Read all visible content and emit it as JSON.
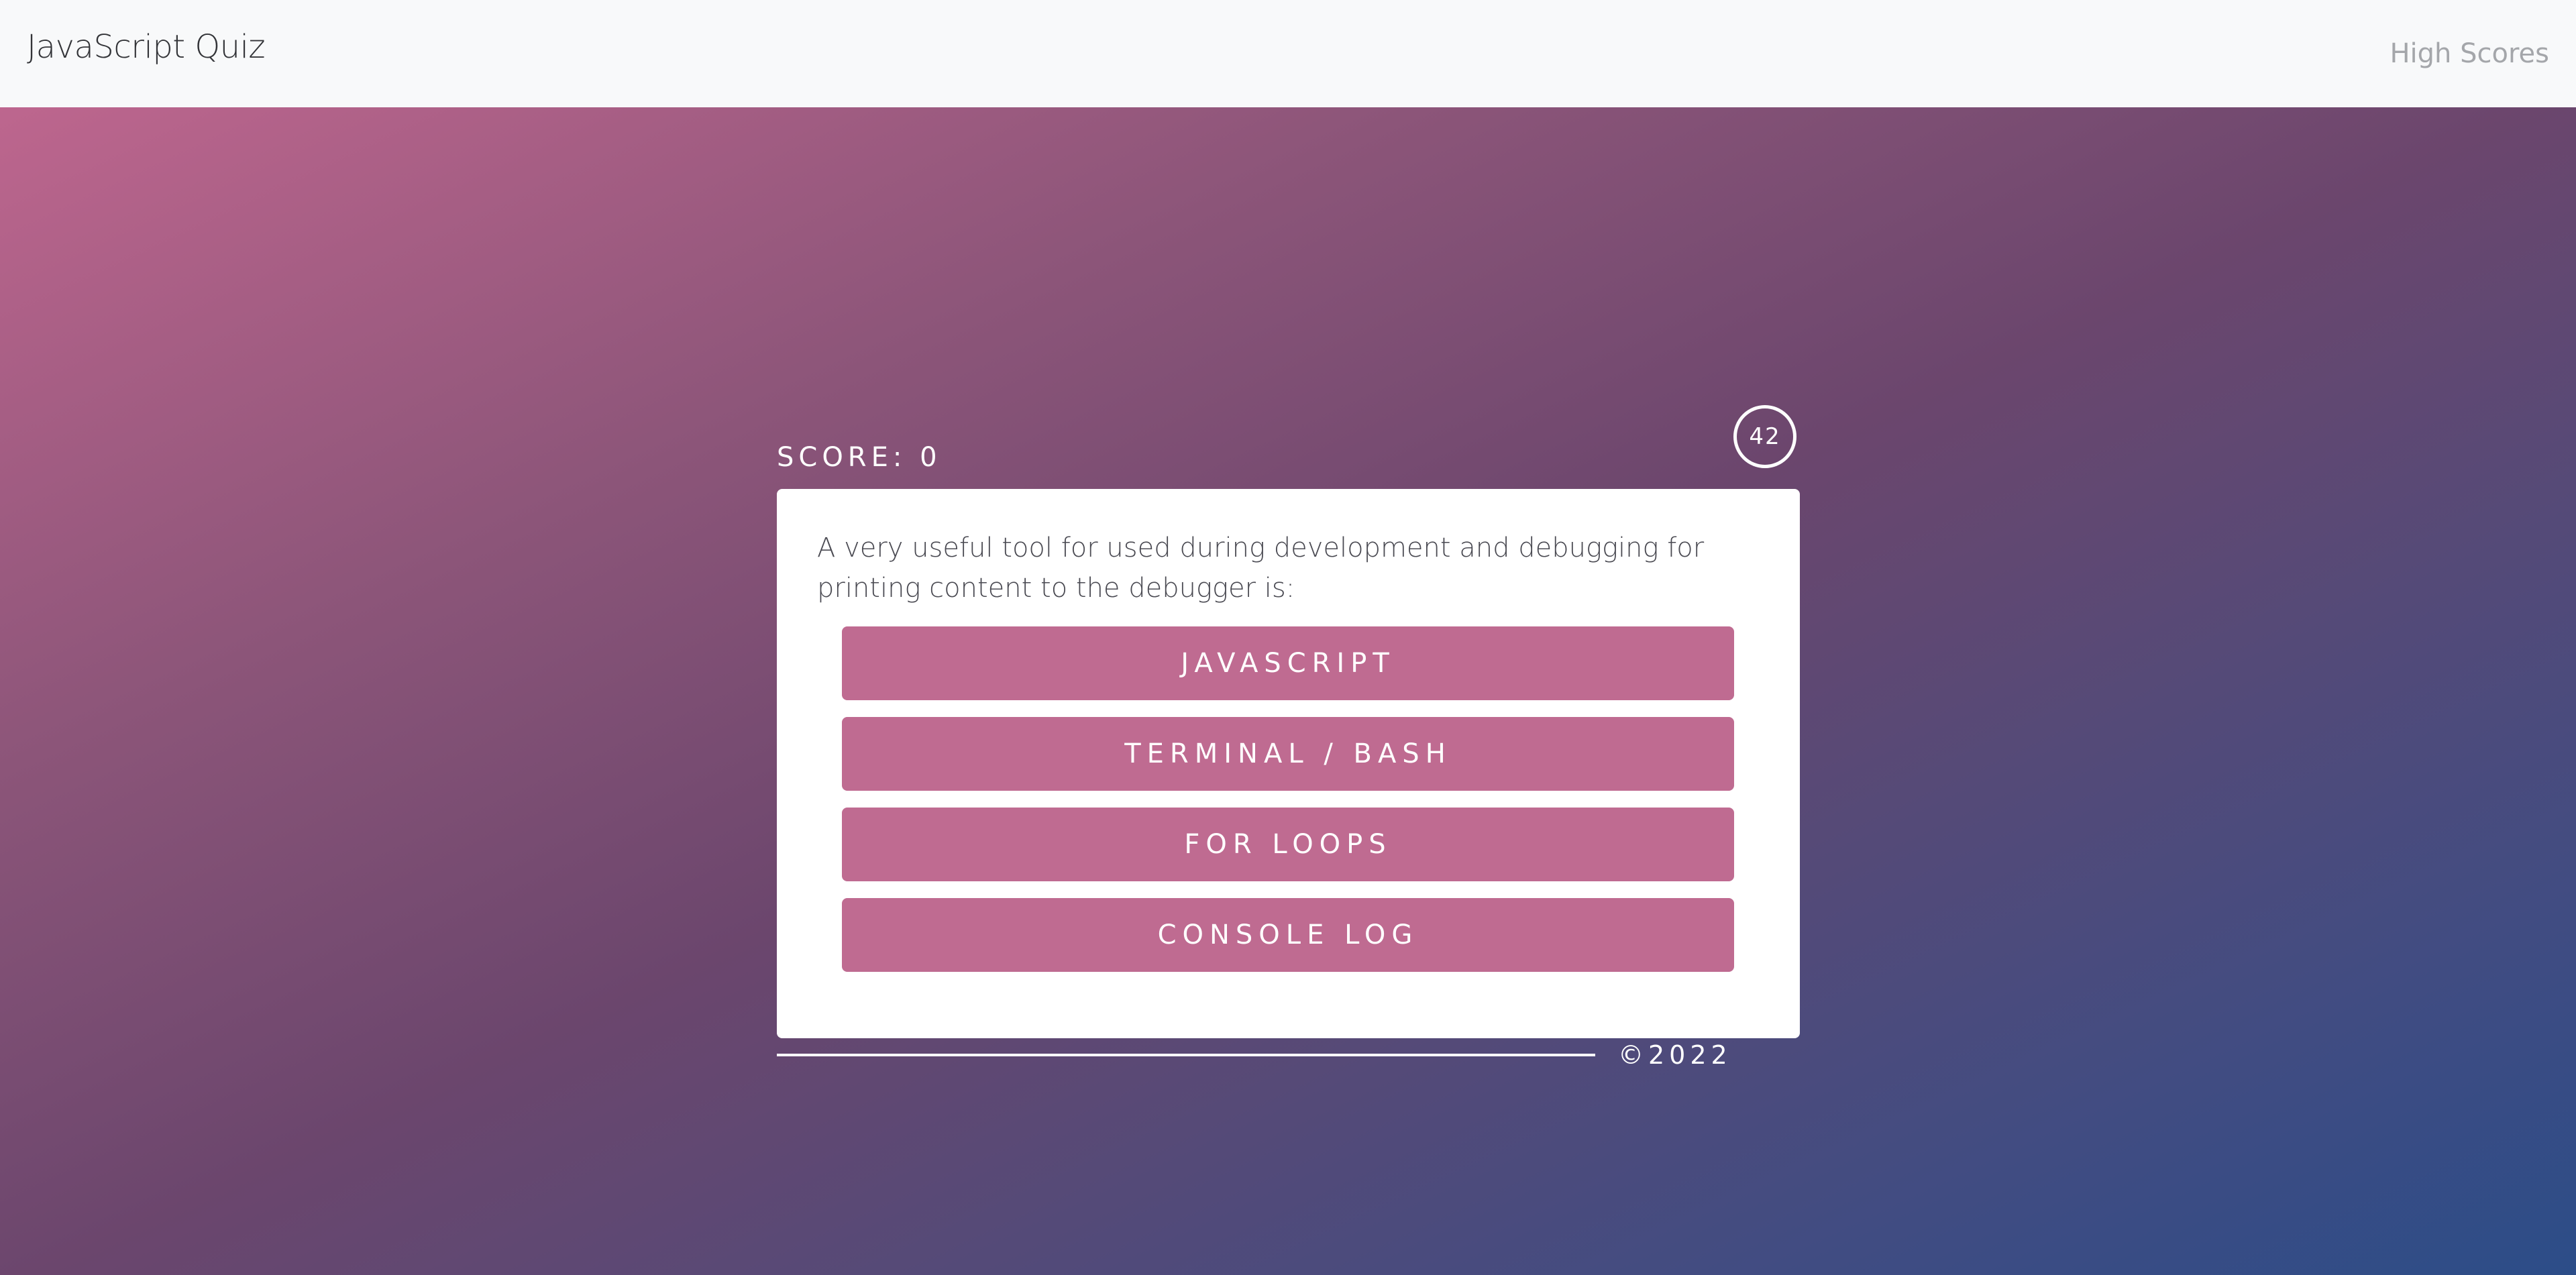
{
  "navbar": {
    "brand": "JavaScript Quiz",
    "high_scores_link": "High Scores"
  },
  "quiz": {
    "score_label": "SCORE: 0",
    "timer_value": "42",
    "question": "A very useful tool for used during development and debugging for printing content to the debugger is:",
    "answers": [
      {
        "label": "JAVASCRIPT"
      },
      {
        "label": "TERMINAL / BASH"
      },
      {
        "label": "FOR LOOPS"
      },
      {
        "label": "CONSOLE LOG"
      }
    ]
  },
  "footer": {
    "copyright": "©2022"
  },
  "colors": {
    "navbar_bg": "#f8f9fa",
    "answer_button_bg": "#bf6b91",
    "gradient_start": "#bd668e",
    "gradient_end": "#2c4d88",
    "card_bg": "#ffffff"
  }
}
